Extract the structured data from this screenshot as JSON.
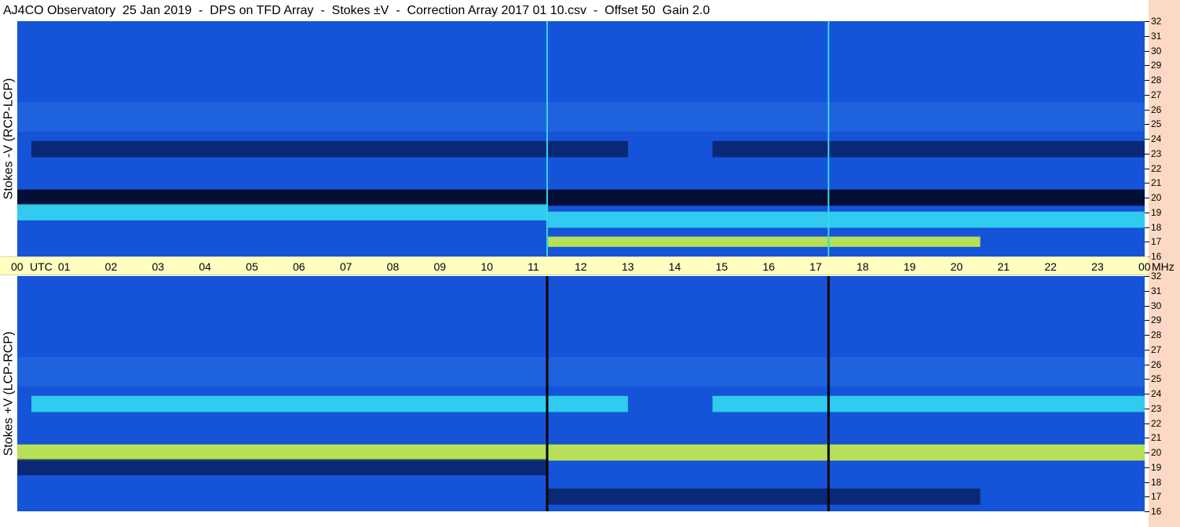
{
  "header": {
    "title": "AJ4CO Observatory  25 Jan 2019  -  DPS on TFD Array  -  Stokes ±V  -  Correction Array 2017 01 10.csv  -  Offset 50  Gain 2.0"
  },
  "colors": {
    "background_blue": "#1553d8",
    "light_blue": "#3f8ff0",
    "cyan": "#33d8f0",
    "yellow_green": "#c8f048",
    "dark_navy": "#051a55",
    "axis_band": "#ffffc0",
    "right_strip": "#fbd9c4"
  },
  "chart_data": [
    {
      "type": "heatmap",
      "ylabel": "Stokes -V (RCP-LCP)",
      "x_tick_labels": [
        "00",
        "UTC",
        "01",
        "02",
        "03",
        "04",
        "05",
        "06",
        "07",
        "08",
        "09",
        "10",
        "11",
        "12",
        "13",
        "14",
        "15",
        "16",
        "17",
        "18",
        "19",
        "20",
        "21",
        "22",
        "23",
        "00"
      ],
      "y_tick_labels": [
        "32",
        "31",
        "30",
        "29",
        "28",
        "27",
        "26",
        "25",
        "24",
        "23",
        "22",
        "21",
        "20",
        "19",
        "18",
        "17",
        "16"
      ],
      "y_unit": "MHz",
      "xlim": [
        0,
        24
      ],
      "ylim": [
        16,
        32
      ],
      "bands": [
        {
          "freq_mhz": 23.3,
          "level": "dark",
          "hours": [
            0.3,
            13.0
          ]
        },
        {
          "freq_mhz": 23.3,
          "level": "dark",
          "hours": [
            14.8,
            24.0
          ]
        },
        {
          "freq_mhz": 20.0,
          "level": "darkest",
          "hours": [
            0.0,
            24.0
          ]
        },
        {
          "freq_mhz": 19.0,
          "level": "cyan",
          "hours": [
            0.0,
            11.3
          ]
        },
        {
          "freq_mhz": 18.5,
          "level": "cyan",
          "hours": [
            11.3,
            24.0
          ]
        },
        {
          "freq_mhz": 17.0,
          "level": "hot",
          "hours": [
            11.3,
            20.5
          ]
        }
      ],
      "vertical_lines_hours": [
        11.28,
        17.27
      ],
      "vertical_line_color": "cyan"
    },
    {
      "type": "heatmap",
      "ylabel": "Stokes +V (LCP-RCP)",
      "y_tick_labels": [
        "32",
        "31",
        "30",
        "29",
        "28",
        "27",
        "26",
        "25",
        "24",
        "23",
        "22",
        "21",
        "20",
        "19",
        "18",
        "17",
        "16"
      ],
      "y_unit": "MHz",
      "xlim": [
        0,
        24
      ],
      "ylim": [
        16,
        32
      ],
      "bands": [
        {
          "freq_mhz": 23.3,
          "level": "cyan",
          "hours": [
            0.3,
            13.0
          ]
        },
        {
          "freq_mhz": 23.3,
          "level": "cyan",
          "hours": [
            14.8,
            24.0
          ]
        },
        {
          "freq_mhz": 20.0,
          "level": "hot",
          "hours": [
            0.0,
            24.0
          ]
        },
        {
          "freq_mhz": 19.0,
          "level": "dark",
          "hours": [
            0.0,
            11.3
          ]
        },
        {
          "freq_mhz": 17.0,
          "level": "dark",
          "hours": [
            11.3,
            20.5
          ]
        }
      ],
      "vertical_lines_hours": [
        11.28,
        17.27
      ],
      "vertical_line_color": "black"
    }
  ]
}
